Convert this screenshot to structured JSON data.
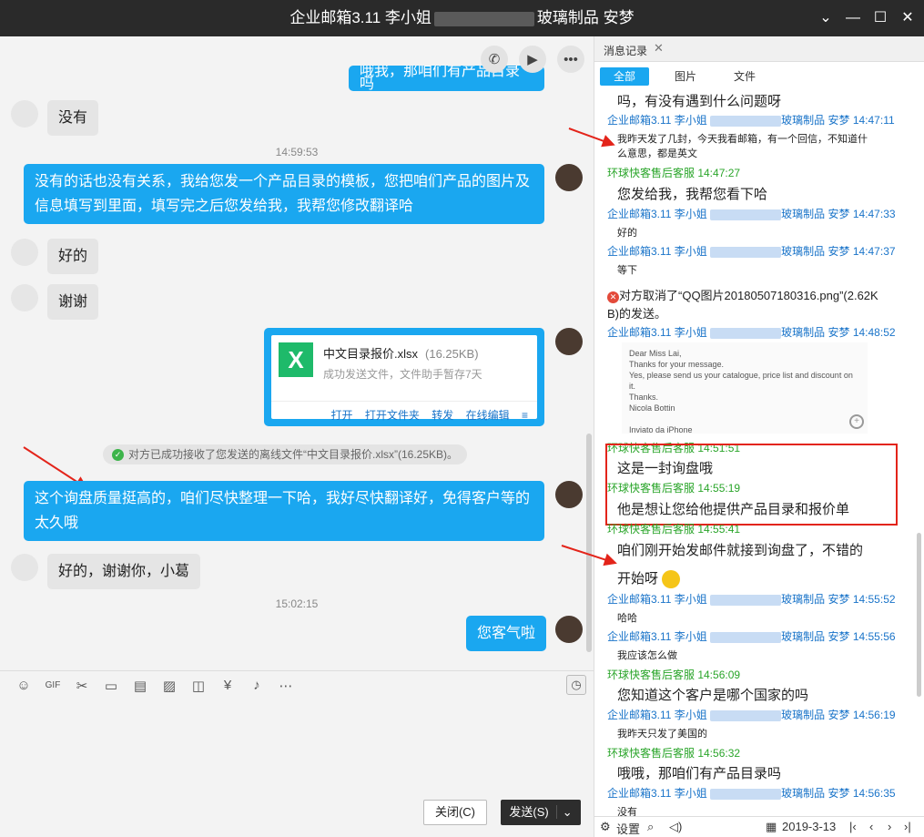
{
  "window": {
    "title_left": "企业邮箱3.11 李小姐",
    "title_right": "玻璃制品 安梦"
  },
  "chat": {
    "top_partial": "哦我，那咱们有产品目录吗",
    "m1": "没有",
    "ts1": "14:59:53",
    "m2": "没有的话也没有关系，我给您发一个产品目录的模板，您把咱们产品的图片及信息填写到里面，填写完之后您发给我，我帮您修改翻译哈",
    "m3": "好的",
    "m4": "谢谢",
    "file": {
      "icon": "X",
      "name": "中文目录报价.xlsx",
      "size": "(16.25KB)",
      "status": "成功发送文件，文件助手暂存7天",
      "actions": [
        "打开",
        "打开文件夹",
        "转发",
        "在线编辑"
      ]
    },
    "notice": "对方已成功接收了您发送的离线文件“中文目录报价.xlsx”(16.25KB)。",
    "m5": "这个询盘质量挺高的，咱们尽快整理一下哈，我好尽快翻译好，免得客户等的太久哦",
    "m6": "好的，谢谢你，小葛",
    "ts2": "15:02:15",
    "m7": "您客气啦"
  },
  "input": {
    "close": "关闭(C)",
    "send": "发送(S)"
  },
  "history": {
    "tab": "消息记录",
    "filters": [
      "全部",
      "图片",
      "文件"
    ],
    "r0": "吗，有没有遇到什么问题呀",
    "s1": "企业邮箱3.11 李小姐",
    "s1b": "玻璃制品 安梦 14:47:11",
    "r1": "我昨天发了几封，今天我看邮箱，有一个回信，不知道什",
    "r1b": "么意思，都是英文",
    "g1": "环球快客售后客服 14:47:27",
    "r2": "您发给我，我帮您看下哈",
    "s2": "企业邮箱3.11 李小姐",
    "s2b": "玻璃制品 安梦 14:47:33",
    "r3": "好的",
    "s3": "企业邮箱3.11 李小姐",
    "s3b": "玻璃制品 安梦 14:47:37",
    "r4": "等下",
    "cancel1": "对方取消了“QQ图片20180507180316.png”(2.62K",
    "cancel2": "B)的发送。",
    "s4": "企业邮箱3.11 李小姐",
    "s4b": "玻璃制品 安梦 14:48:52",
    "email": [
      "Dear Miss Lai,",
      "Thanks for your message.",
      "Yes, please send us your catalogue, price list and discount on it.",
      "Thanks.",
      "Nicola Bottin",
      "",
      "Inviato da iPhone"
    ],
    "g2": "环球快客售后客服 14:51:51",
    "r5": "这是一封询盘哦",
    "g3": "环球快客售后客服 14:55:19",
    "r6": "他是想让您给他提供产品目录和报价单",
    "g4": "环球快客售后客服 14:55:41",
    "r7": "咱们刚开始发邮件就接到询盘了，不错的",
    "r7b": "开始呀",
    "s5": "企业邮箱3.11 李小姐",
    "s5b": "玻璃制品 安梦 14:55:52",
    "r8": "哈哈",
    "s6": "企业邮箱3.11 李小姐",
    "s6b": "玻璃制品 安梦 14:55:56",
    "r9": "我应该怎么做",
    "g5": "环球快客售后客服 14:56:09",
    "r10": "您知道这个客户是哪个国家的吗",
    "s7": "企业邮箱3.11 李小姐",
    "s7b": "玻璃制品 安梦 14:56:19",
    "r11": "我昨天只发了美国的",
    "g6": "环球快客售后客服 14:56:32",
    "r12": "哦哦，那咱们有产品目录吗",
    "s8": "企业邮箱3.11 李小姐",
    "s8b": "玻璃制品 安梦 14:56:35",
    "r13": "没有",
    "settings": "设置",
    "date": "2019-3-13"
  }
}
